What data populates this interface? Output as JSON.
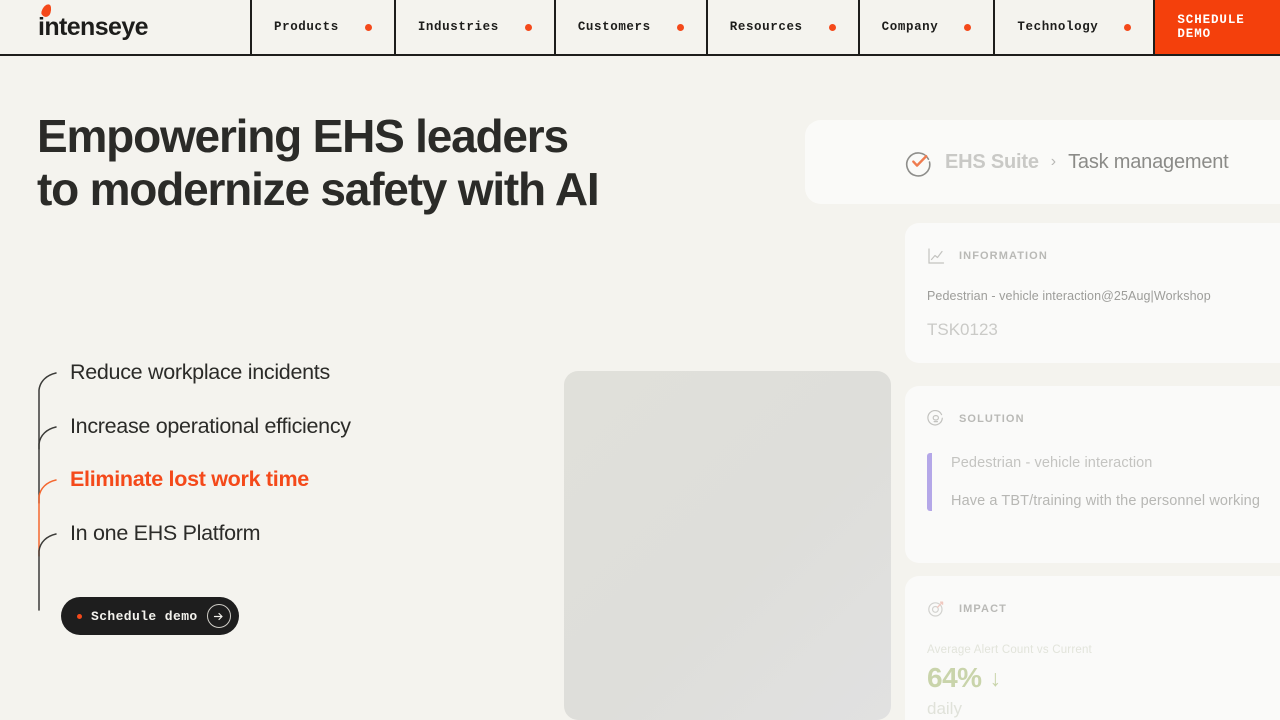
{
  "brand": {
    "name": "intenseye",
    "accent_color": "#f4491a"
  },
  "nav": {
    "items": [
      {
        "label": "Products",
        "dot": true
      },
      {
        "label": "Industries",
        "dot": true
      },
      {
        "label": "Customers",
        "dot": true
      },
      {
        "label": "Resources",
        "dot": true
      },
      {
        "label": "Company",
        "dot": true
      },
      {
        "label": "Technology",
        "dot": true
      }
    ],
    "cta": {
      "label": "SCHEDULE DEMO",
      "bg_color": "#f4400c"
    }
  },
  "hero": {
    "headline": "Empowering EHS leaders\nto modernize safety with AI",
    "bullets": [
      {
        "text": "Reduce workplace incidents",
        "accent": false,
        "mark_color": "#3b3b38"
      },
      {
        "text": "Increase operational efficiency",
        "accent": false,
        "mark_color": "#3b3b38"
      },
      {
        "text": "Eliminate lost work time",
        "accent": true,
        "mark_color": "#f4672f"
      },
      {
        "text": "In one EHS Platform",
        "accent": false,
        "mark_color": "#3b3b38"
      }
    ],
    "cta": {
      "label": "Schedule demo",
      "icon": "arrow-right-circle-icon"
    }
  },
  "dashboard": {
    "breadcrumb": {
      "icon": "check-circle-icon",
      "parent": "EHS Suite",
      "separator": "›",
      "current": "Task management"
    },
    "sections": [
      {
        "key": "information",
        "icon": "line-chart-icon",
        "title": "INFORMATION",
        "line1": "Pedestrian - vehicle interaction@25Aug|Workshop",
        "line2": "TSK0123"
      },
      {
        "key": "solution",
        "icon": "lightbulb-circle-icon",
        "title": "SOLUTION",
        "quote_line1": "Pedestrian - vehicle interaction",
        "quote_line2": "Have a TBT/training with the personnel working",
        "accent_color": "#b4a7e8"
      },
      {
        "key": "impact",
        "icon": "target-icon",
        "title": "IMPACT",
        "caption": "Average Alert Count vs Current",
        "value": "64%",
        "trend": "↓",
        "unit": "daily",
        "value_color": "#c9d4ab"
      }
    ]
  }
}
